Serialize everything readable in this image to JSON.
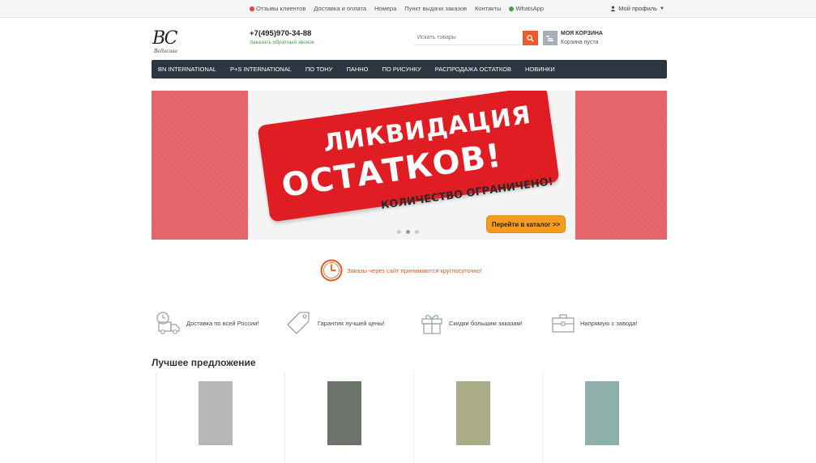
{
  "topbar": {
    "links": [
      {
        "label": "Отзывы клиентов",
        "icon": "dot-red-icon"
      },
      {
        "label": "Доставка и оплата",
        "icon": ""
      },
      {
        "label": "Номера",
        "icon": ""
      },
      {
        "label": "Пункт выдачи заказов",
        "icon": ""
      },
      {
        "label": "Контакты",
        "icon": ""
      },
      {
        "label": "WhatsApp",
        "icon": "dot-green-icon"
      }
    ],
    "profile_label": "Мой профиль"
  },
  "header": {
    "logo_mono": "BC",
    "logo_sub": "Bellacasa",
    "phone": "+7(495)970-34-88",
    "callback": "Заказать обратный звонок",
    "search_placeholder": "Искать товары",
    "cart_title": "МОЯ КОРЗИНА",
    "cart_status": "Корзина пуста"
  },
  "nav": {
    "items": [
      "BN INTERNATIONAL",
      "P+S INTERNATIONAL",
      "ПО ТОНУ",
      "ПАННО",
      "ПО РИСУНКУ",
      "РАСПРОДАЖА ОСТАТКОВ",
      "НОВИНКИ"
    ]
  },
  "banner": {
    "line1": "ЛИКВИДАЦИЯ",
    "line2": "ОСТАТКОВ!",
    "limited": "КОЛИЧЕСТВО ОГРАНИЧЕНО!",
    "button": "Перейти в каталог >>",
    "active_slide": 2,
    "slides": 3
  },
  "notice": "Заказы через сайт принимаются круглосуточно!",
  "features": [
    {
      "label": "Доставка по всей России!",
      "icon": "delivery-truck-icon"
    },
    {
      "label": "Гарантия лучшей цены!",
      "icon": "price-tag-icon"
    },
    {
      "label": "Скидки большим заказам!",
      "icon": "gift-icon"
    },
    {
      "label": "Напрямую с завода!",
      "icon": "toolbox-icon"
    }
  ],
  "best_offer": {
    "title": "Лучшее предложение",
    "products": [
      {
        "color": "#b5b8b7"
      },
      {
        "color": "#6b736b"
      },
      {
        "color": "#a9ac86"
      },
      {
        "color": "#8fb0aa"
      }
    ]
  },
  "colors": {
    "accent": "#f05a28",
    "nav_bg": "#2d3640",
    "banner_red": "#e01d22",
    "notice_orange": "#e05a1e"
  }
}
